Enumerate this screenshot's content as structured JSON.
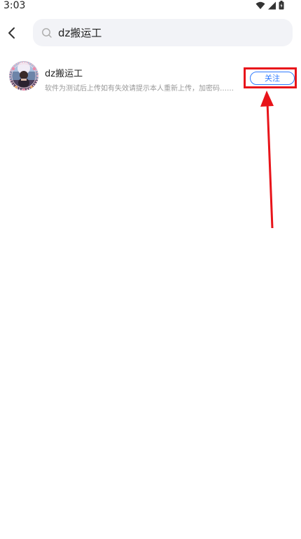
{
  "status_bar": {
    "time": "3:03",
    "icons": [
      "wifi-icon",
      "signal-icon",
      "battery-icon"
    ]
  },
  "header": {
    "back_icon": "chevron-left-icon",
    "search": {
      "icon": "search-icon",
      "value": "dz搬运工"
    }
  },
  "results": [
    {
      "name": "dz搬运工",
      "description": "软件为测试后上传如有失效请提示本人重新上传，加密码……",
      "follow_label": "关注"
    }
  ],
  "colors": {
    "accent": "#2f7bff",
    "annotation": "#e8141a",
    "search_background": "#f2f3f7"
  }
}
